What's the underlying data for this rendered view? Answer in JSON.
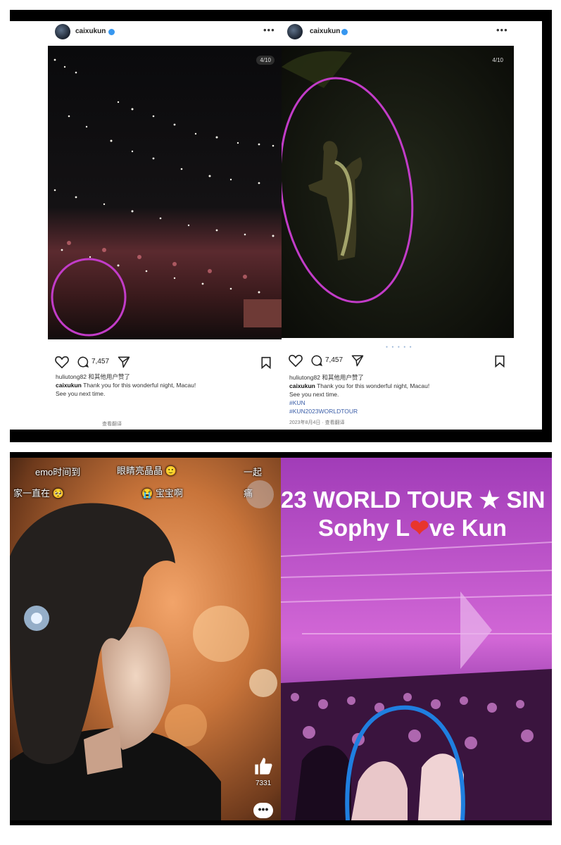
{
  "posts": [
    {
      "username": "caixukun",
      "counter": "4/10",
      "comment_count": "7,457",
      "likes_line": "huliutong82 和其他用户赞了",
      "caption_user": "caixukun",
      "caption_text": "Thank you for this wonderful night, Macau!",
      "caption_line2": "See you next time.",
      "footer": "查看翻译"
    },
    {
      "username": "caixukun",
      "counter": "4/10",
      "comment_count": "7,457",
      "likes_line": "huliutong82 和其他用户赞了",
      "caption_user": "caixukun",
      "caption_text": "Thank you for this wonderful night, Macau!",
      "caption_line2": "See you next time.",
      "hashtag1": "#KUN",
      "hashtag2": "#KUN2023WORLDTOUR",
      "date": "2023年8月4日",
      "footer": "查看翻译"
    }
  ],
  "danmu": {
    "d1": "emo时间到",
    "d2": "眼睛亮晶晶",
    "d3": "一起",
    "d4": "家一直在",
    "d5": "宝宝啊",
    "d6": "痛"
  },
  "video_like_count": "7331",
  "tour": {
    "line1": "23 WORLD TOUR ★ SIN",
    "line2_a": "Sophy L",
    "line2_b": "ve Kun"
  },
  "colors": {
    "highlight_circle": "#c23cc8",
    "blue_circle": "#1f7fe0",
    "heart": "#e8352c",
    "verified": "#3797f0"
  },
  "icons": [
    "heart-icon",
    "comment-icon",
    "share-icon",
    "bookmark-icon",
    "thumbs-up-icon",
    "more-icon",
    "play-icon"
  ]
}
